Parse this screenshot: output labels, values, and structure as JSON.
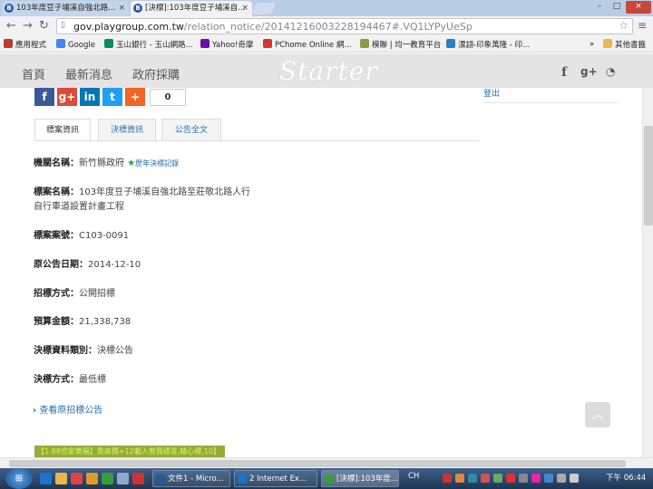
{
  "browser": {
    "tabs": [
      {
        "label": "103年度豆子埔溪自強北路...",
        "icon": "B",
        "close": "×"
      },
      {
        "label": "[決標]:103年度豆子埔溪自...",
        "icon": "B",
        "close": "×"
      }
    ],
    "window_controls": [
      "–",
      "□",
      "×"
    ],
    "url": {
      "domain": "gov.playgroup.com.tw",
      "path": "/relation_notice/20141216003228194467#.VQ1LYPyUeSp"
    },
    "bookmarks": [
      {
        "label": "應用程式",
        "color": "#c0392b"
      },
      {
        "label": "Google",
        "color": "#4285f4"
      },
      {
        "label": "玉山銀行 - 玉山網路...",
        "color": "#0b8a5a"
      },
      {
        "label": "Yahoo!奇摩",
        "color": "#6a0dad"
      },
      {
        "label": "PChome Online 網...",
        "color": "#d8342c"
      },
      {
        "label": "模聯 | 均一教育平台",
        "color": "#8a9a3a"
      },
      {
        "label": "漂翃-印象萬隆 - 印...",
        "color": "#2b7fc0"
      }
    ],
    "bookmarks_more": "»",
    "other_bookmarks": "其他書籤"
  },
  "site": {
    "menu": [
      "首頁",
      "最新消息",
      "政府採購"
    ],
    "logo": "Starter",
    "social": [
      "f",
      "g+",
      "rss"
    ]
  },
  "share": {
    "buttons": [
      "f",
      "g+",
      "in",
      "t",
      "+"
    ],
    "colors": [
      "#3b5998",
      "#dd4b39",
      "#0077b5",
      "#1da1f2",
      "#f26522"
    ],
    "count": "0"
  },
  "sidebar": {
    "login": "登出"
  },
  "content_tabs": [
    "標案資訊",
    "決標資訊",
    "公告全文"
  ],
  "fields": [
    {
      "label": "機關名稱：",
      "value": "新竹縣政府",
      "extra": "歷年決標記錄"
    },
    {
      "label": "標案名稱：",
      "value": "103年度豆子埔溪自強北路至莊敬北路人行自行車道設置計畫工程"
    },
    {
      "label": "標案案號：",
      "value": "C103-0091"
    },
    {
      "label": "原公告日期：",
      "value": "2014-12-10"
    },
    {
      "label": "招標方式：",
      "value": "公開招標"
    },
    {
      "label": "預算金額：",
      "value": "21,338,738"
    },
    {
      "label": "決標資料類別：",
      "value": "決標公告"
    },
    {
      "label": "決標方式：",
      "value": "最低標"
    }
  ],
  "view_original": "查看原招標公告",
  "scroll_top": "︿",
  "ad_banner": "【1.88倍家樂福】貴高價+12載入曾我標准,精心標,10】",
  "taskbar": {
    "start": "⊞",
    "tasks": [
      "文件1 - Micro...",
      "2 Internet Ex...",
      "[決標]:103年度..."
    ],
    "lang": "CH",
    "clock": "下午 06:44"
  }
}
